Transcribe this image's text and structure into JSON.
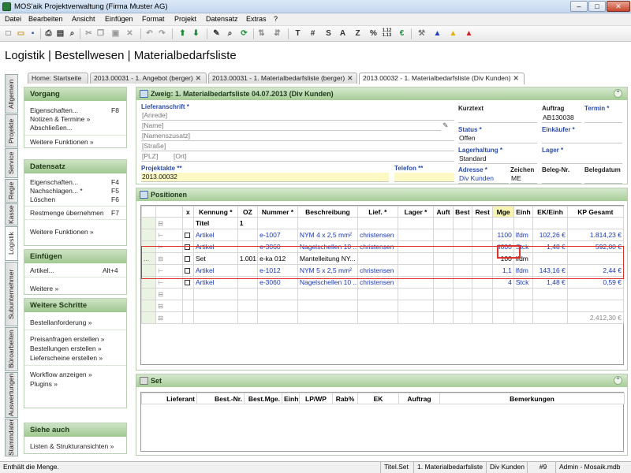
{
  "app": {
    "title": "MOS'aik Projektverwaltung (Firma Muster AG)"
  },
  "menu": [
    "Datei",
    "Bearbeiten",
    "Ansicht",
    "Einfügen",
    "Format",
    "Projekt",
    "Datensatz",
    "Extras",
    "?"
  ],
  "toolbar": {
    "text_buttons": [
      "T",
      "#",
      "S",
      "A",
      "Z",
      "%"
    ],
    "sub_123": "1.12\n1.13"
  },
  "heading": "Logistik | Bestellwesen | Materialbedarfsliste",
  "tabs": [
    {
      "label": "Home: Startseite"
    },
    {
      "label": "2013.00031 - 1. Angebot (berger)"
    },
    {
      "label": "2013.00031 - 1. Materialbedarfsliste (berger)"
    },
    {
      "label": "2013.00032 - 1. Materialbedarfsliste (Div Kunden)"
    }
  ],
  "vtabs": [
    "Allgemein",
    "Projekte",
    "Service",
    "Regie",
    "Kasse",
    "Logistik",
    "Subunternehmer",
    "Büroarbeiten",
    "Auswertungen",
    "Stammdaten"
  ],
  "sidebar": {
    "vorgang": {
      "title": "Vorgang",
      "items": [
        {
          "label": "Eigenschaften...",
          "key": "F8"
        },
        {
          "label": "Notizen & Termine »",
          "key": ""
        },
        {
          "label": "Abschließen...",
          "key": ""
        }
      ],
      "more": "Weitere Funktionen »"
    },
    "datensatz": {
      "title": "Datensatz",
      "items": [
        {
          "label": "Eigenschaften...",
          "key": "F4"
        },
        {
          "label": "Nachschlagen... *",
          "key": "F5"
        },
        {
          "label": "Löschen",
          "key": "F6"
        }
      ],
      "extra": {
        "label": "Restmenge übernehmen",
        "key": "F7"
      },
      "more": "Weitere Funktionen »"
    },
    "einfuegen": {
      "title": "Einfügen",
      "items": [
        {
          "label": "Artikel...",
          "key": "Alt+4"
        }
      ],
      "more": "Weitere »"
    },
    "schritte": {
      "title": "Weitere Schritte",
      "items": [
        "Bestellanforderung »",
        "Preisanfragen erstellen »",
        "Bestellungen erstellen »",
        "Lieferscheine erstellen »",
        "Workflow anzeigen »",
        "Plugins »"
      ]
    },
    "siehe": {
      "title": "Siehe auch",
      "items": [
        "Listen & Strukturansichten »"
      ]
    }
  },
  "header_box": {
    "title": "Zweig: 1. Materialbedarfsliste 04.07.2013 (Div Kunden)",
    "lieferanschrift_label": "Lieferanschrift *",
    "fields": {
      "anrede": "[Anrede]",
      "name": "[Name]",
      "namenszusatz": "[Namenszusatz]",
      "strasse": "[Straße]",
      "plz": "[PLZ]",
      "ort": "[Ort]"
    },
    "projektakte_label": "Projektakte **",
    "projektakte_value": "2013.00032",
    "telefon_label": "Telefon **",
    "kurztext_label": "Kurztext",
    "auftrag_label": "Auftrag",
    "auftrag_value": "AB130038",
    "termin_label": "Termin *",
    "status_label": "Status *",
    "status_value": "Offen",
    "einkaeufer_label": "Einkäufer *",
    "lagerhaltung_label": "Lagerhaltung *",
    "lagerhaltung_value": "Standard",
    "lager_label": "Lager *",
    "adresse_label": "Adresse *",
    "adresse_value": "Div Kunden",
    "zeichen_label": "Zeichen",
    "zeichen_value": "ME",
    "belegnr_label": "Beleg-Nr.",
    "belegdatum_label": "Belegdatum"
  },
  "positionen": {
    "title": "Positionen",
    "columns": [
      "",
      "x",
      "Kennung *",
      "OZ",
      "Nummer *",
      "Beschreibung",
      "Lief. *",
      "Lager *",
      "Auft",
      "Best",
      "Rest",
      "Mge",
      "Einh",
      "EK/Einh",
      "KP Gesamt"
    ],
    "rows": [
      {
        "cb": false,
        "kennung": "Titel",
        "oz": "1",
        "nummer": "",
        "beschreibung": "",
        "lief": "",
        "mge": "",
        "einh": "",
        "ek": "",
        "kp": "",
        "blue": false,
        "bold": true
      },
      {
        "cb": true,
        "kennung": "Artikel",
        "oz": "",
        "nummer": "e-1007",
        "beschreibung": "NYM 4 x 2,5 mm²",
        "lief": "christensen",
        "mge": "1100",
        "einh": "lfdm",
        "ek": "102,26 €",
        "kp": "1.814,23 €",
        "blue": true
      },
      {
        "cb": true,
        "kennung": "Artikel",
        "oz": "",
        "nummer": "e-3060",
        "beschreibung": "Nagelschellen 10 ...",
        "lief": "christensen",
        "mge": "4000",
        "einh": "Stck",
        "ek": "1,48 €",
        "kp": "592,00 €",
        "blue": true
      },
      {
        "cb": true,
        "kennung": "Set",
        "oz": "1.001",
        "nummer": "e-ka 012",
        "beschreibung": "Mantelleitung NY...",
        "lief": "",
        "mge": "100",
        "einh": "lfdm",
        "ek": "",
        "kp": "",
        "blue": false,
        "marker": "..."
      },
      {
        "cb": true,
        "kennung": "Artikel",
        "oz": "",
        "nummer": "e-1012",
        "beschreibung": "NYM 5 x 2,5 mm²",
        "lief": "christensen",
        "mge": "1,1",
        "einh": "lfdm",
        "ek": "143,16 €",
        "kp": "2,44 €",
        "blue": true
      },
      {
        "cb": true,
        "kennung": "Artikel",
        "oz": "",
        "nummer": "e-3060",
        "beschreibung": "Nagelschellen 10 ...",
        "lief": "christensen",
        "mge": "4",
        "einh": "Stck",
        "ek": "1,48 €",
        "kp": "0,59 €",
        "blue": true
      }
    ],
    "total": "2.412,30 €"
  },
  "set": {
    "title": "Set",
    "columns": [
      "Lieferant",
      "Best.-Nr.",
      "Best.Mge.",
      "Einh",
      "LP/WP",
      "Rab%",
      "EK",
      "Auftrag",
      "Bemerkungen"
    ]
  },
  "statusbar": {
    "message": "Enthält die Menge.",
    "cells": [
      "Titel.Set",
      "1. Materialbedarfsliste",
      "Div Kunden",
      "#9",
      "Admin - Mosaik.mdb"
    ]
  },
  "colors": {
    "panel_header": "#a7cd97",
    "label_blue": "#2a4ba8",
    "link_blue": "#1a38b8",
    "selection_red": "#e0302a",
    "yellow_field": "#fdf9c4"
  }
}
